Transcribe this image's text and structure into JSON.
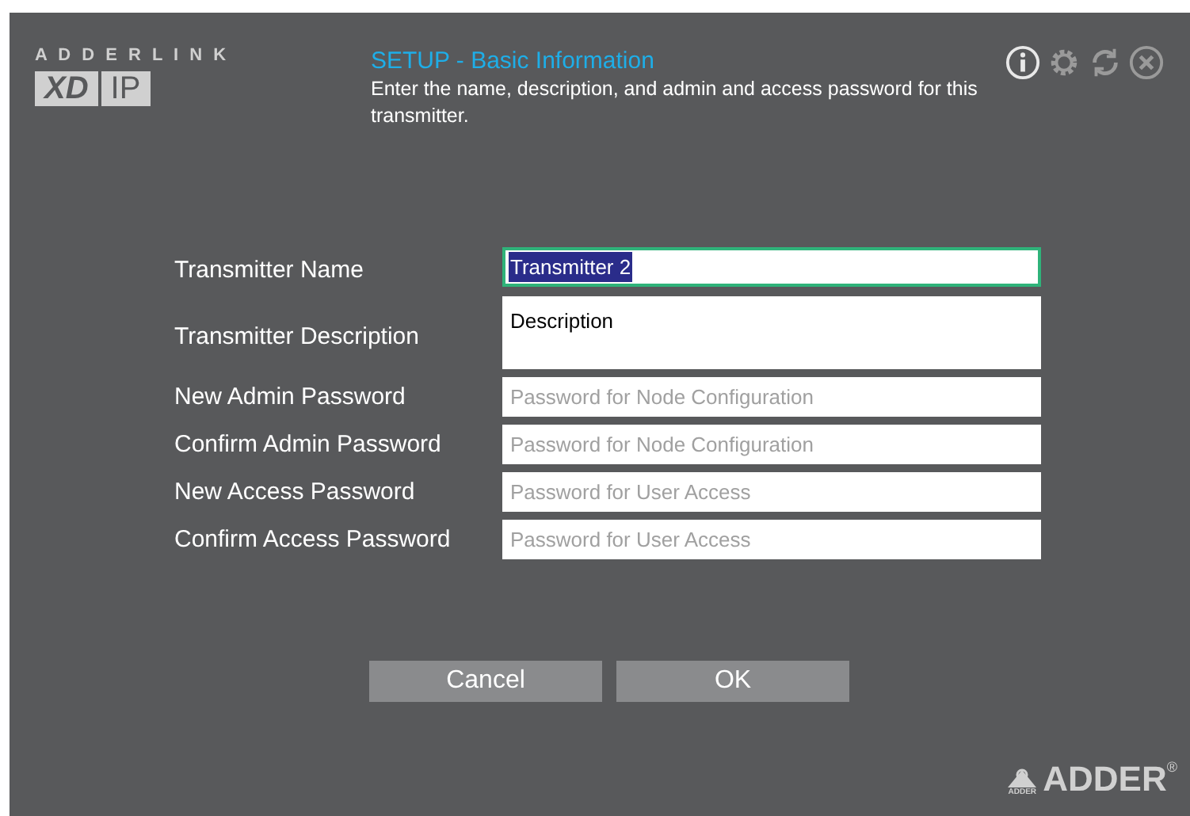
{
  "logo": {
    "top_text": "A D D E R L I N K",
    "product_left": "XD",
    "product_right": "IP"
  },
  "header": {
    "title": "SETUP - Basic Information",
    "description": "Enter the name, description, and admin and access password for this transmitter."
  },
  "fields": [
    {
      "label": "Transmitter Name",
      "kind": "text",
      "value": "Transmitter 2",
      "focused": true,
      "value_selected": true
    },
    {
      "label": "Transmitter Description",
      "kind": "multiline",
      "value": "Description",
      "focused": false
    },
    {
      "label": "New Admin Password",
      "kind": "password",
      "placeholder": "Password for Node Configuration",
      "focused": false
    },
    {
      "label": "Confirm Admin Password",
      "kind": "password",
      "placeholder": "Password for Node Configuration",
      "focused": false
    },
    {
      "label": "New Access Password",
      "kind": "password",
      "placeholder": "Password for User Access",
      "focused": false
    },
    {
      "label": "Confirm Access Password",
      "kind": "password",
      "placeholder": "Password for User Access",
      "focused": false
    }
  ],
  "buttons": [
    "Cancel",
    "OK"
  ],
  "brand": {
    "emblem_text": "ADDER",
    "name": "ADDER",
    "mark": "®"
  }
}
